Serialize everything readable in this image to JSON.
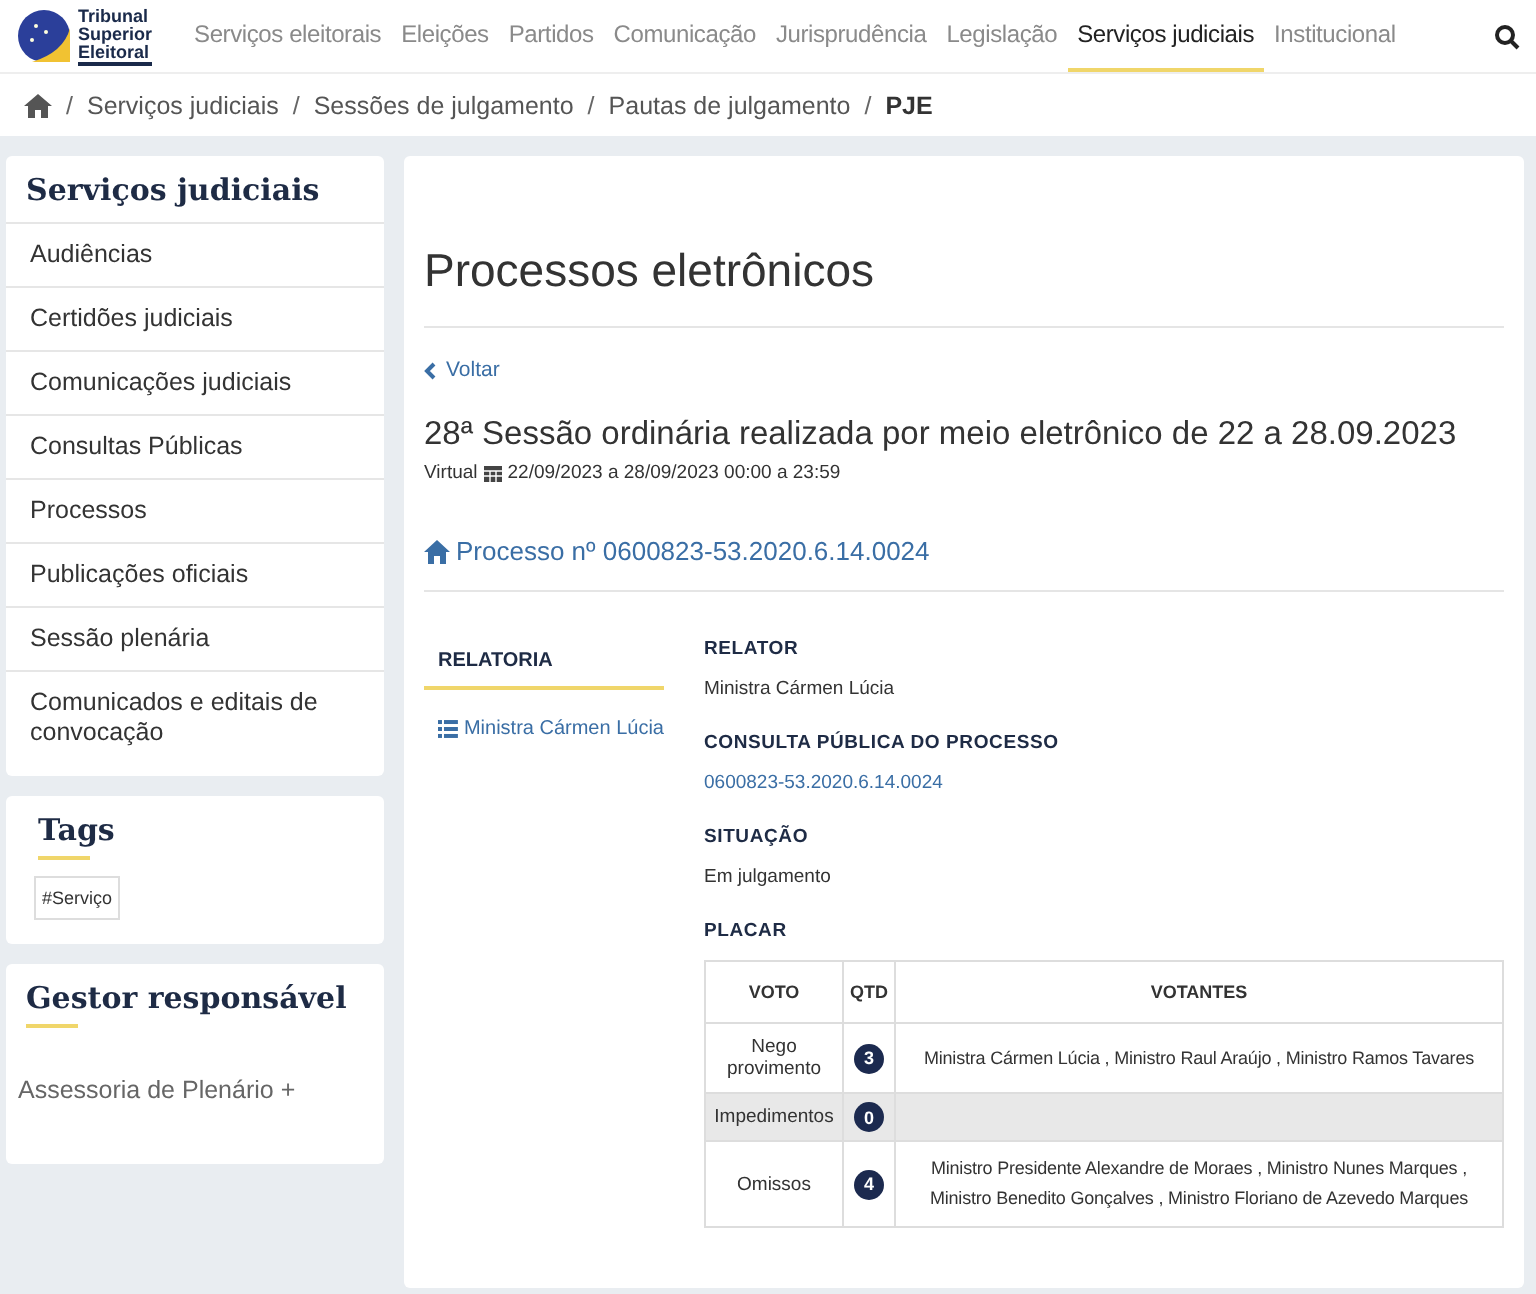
{
  "header": {
    "logo_text": [
      "Tribunal",
      "Superior",
      "Eleitoral"
    ],
    "nav": [
      {
        "label": "Serviços eleitorais",
        "selected": false
      },
      {
        "label": "Eleições",
        "selected": false
      },
      {
        "label": "Partidos",
        "selected": false
      },
      {
        "label": "Comunicação",
        "selected": false
      },
      {
        "label": "Jurisprudência",
        "selected": false
      },
      {
        "label": "Legislação",
        "selected": false
      },
      {
        "label": "Serviços judiciais",
        "selected": true
      },
      {
        "label": "Institucional",
        "selected": false
      }
    ]
  },
  "breadcrumb_separator": "/",
  "breadcrumb": [
    "Serviços judiciais",
    "Sessões de julgamento",
    "Pautas de julgamento",
    "PJE"
  ],
  "sidebar": {
    "title": "Serviços judiciais",
    "items": [
      "Audiências",
      "Certidões judiciais",
      "Comunicações judiciais",
      "Consultas Públicas",
      "Processos",
      "Publicações oficiais",
      "Sessão plenária",
      "Comunicados e editais de convocação"
    ]
  },
  "tags": {
    "title": "Tags",
    "items": [
      "#Serviço"
    ]
  },
  "gestor": {
    "title": "Gestor responsável",
    "text": "Assessoria de Plenário +"
  },
  "main": {
    "title": "Processos eletrônicos",
    "back": "Voltar",
    "session_title": "28ª Sessão ordinária realizada por meio eletrônico de 22 a 28.09.2023",
    "session_type": "Virtual",
    "session_dates": "22/09/2023 a 28/09/2023 00:00 a 23:59",
    "process": "Processo nº 0600823-53.2020.6.14.0024",
    "tab": {
      "label": "RELATORIA",
      "selected": true
    },
    "tab_link": "Ministra Cármen Lúcia",
    "fields": [
      {
        "label": "RELATOR",
        "value": "Ministra Cármen Lúcia",
        "kind": "text"
      },
      {
        "label": "CONSULTA PÚBLICA DO PROCESSO",
        "value": "0600823-53.2020.6.14.0024",
        "kind": "link"
      },
      {
        "label": "SITUAÇÃO",
        "value": "Em julgamento",
        "kind": "text"
      }
    ],
    "placar": {
      "title": "PLACAR",
      "columns": [
        "VOTO",
        "QTD",
        "VOTANTES"
      ],
      "rows": [
        {
          "voto": "Nego provimento",
          "qtd": "3",
          "votantes": "Ministra Cármen Lúcia , Ministro Raul Araújo , Ministro Ramos Tavares",
          "highlighted": false
        },
        {
          "voto": "Impedimentos",
          "qtd": "0",
          "highlighted": true
        },
        {
          "voto": "Omissos",
          "qtd": "4",
          "votantes": "Ministro Presidente Alexandre de Moraes , Ministro Nunes Marques , Ministro Benedito Gonçalves , Ministro Floriano de Azevedo Marques",
          "highlighted": false
        }
      ]
    }
  }
}
